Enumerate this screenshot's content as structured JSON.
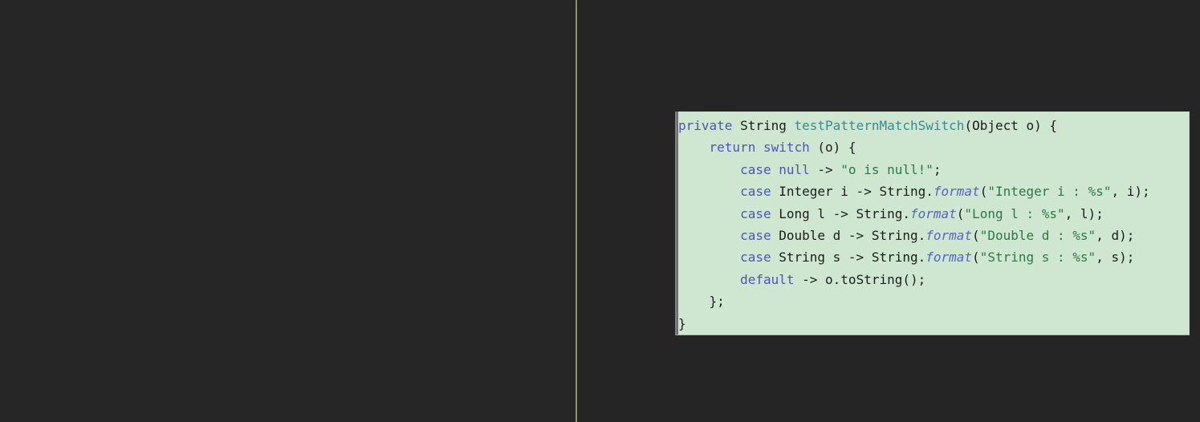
{
  "window": {
    "background_color": "#252525",
    "divider_color": "#8a9a55"
  },
  "panes": {
    "left": {
      "name": "left-editor-pane",
      "content": ""
    },
    "right": {
      "name": "right-editor-pane"
    }
  },
  "code_block": {
    "language": "Java",
    "background_color": "#cfe7d0",
    "colors": {
      "keyword": "#4957b8",
      "method_declaration": "#3a8a95",
      "method_call": "#5566c4",
      "string": "#2a7a45",
      "plain": "#1c1c1c"
    },
    "lines": [
      {
        "index": 1,
        "text": "private String testPatternMatchSwitch(Object o) {",
        "tokens": [
          {
            "t": "private",
            "c": "kw"
          },
          {
            "t": " ",
            "c": "pl"
          },
          {
            "t": "String",
            "c": "type"
          },
          {
            "t": " ",
            "c": "pl"
          },
          {
            "t": "testPatternMatchSwitch",
            "c": "fn"
          },
          {
            "t": "(Object o) {",
            "c": "pl"
          }
        ]
      },
      {
        "index": 2,
        "text": "    return switch (o) {",
        "tokens": [
          {
            "t": "    ",
            "c": "pl"
          },
          {
            "t": "return",
            "c": "kw"
          },
          {
            "t": " ",
            "c": "pl"
          },
          {
            "t": "switch",
            "c": "kw"
          },
          {
            "t": " (o) {",
            "c": "pl"
          }
        ]
      },
      {
        "index": 3,
        "text": "        case null -> \"o is null!\";",
        "tokens": [
          {
            "t": "        ",
            "c": "pl"
          },
          {
            "t": "case",
            "c": "kw"
          },
          {
            "t": " ",
            "c": "pl"
          },
          {
            "t": "null",
            "c": "kw"
          },
          {
            "t": " -> ",
            "c": "pl"
          },
          {
            "t": "\"o is null!\"",
            "c": "str"
          },
          {
            "t": ";",
            "c": "pl"
          }
        ]
      },
      {
        "index": 4,
        "text": "        case Integer i -> String.format(\"Integer i : %s\", i);",
        "tokens": [
          {
            "t": "        ",
            "c": "pl"
          },
          {
            "t": "case",
            "c": "kw"
          },
          {
            "t": " Integer i -> String.",
            "c": "pl"
          },
          {
            "t": "format",
            "c": "meth"
          },
          {
            "t": "(",
            "c": "pl"
          },
          {
            "t": "\"Integer i : %s\"",
            "c": "str"
          },
          {
            "t": ", i);",
            "c": "pl"
          }
        ]
      },
      {
        "index": 5,
        "text": "        case Long l -> String.format(\"Long l : %s\", l);",
        "tokens": [
          {
            "t": "        ",
            "c": "pl"
          },
          {
            "t": "case",
            "c": "kw"
          },
          {
            "t": " Long l -> String.",
            "c": "pl"
          },
          {
            "t": "format",
            "c": "meth"
          },
          {
            "t": "(",
            "c": "pl"
          },
          {
            "t": "\"Long l : %s\"",
            "c": "str"
          },
          {
            "t": ", l);",
            "c": "pl"
          }
        ]
      },
      {
        "index": 6,
        "text": "        case Double d -> String.format(\"Double d : %s\", d);",
        "tokens": [
          {
            "t": "        ",
            "c": "pl"
          },
          {
            "t": "case",
            "c": "kw"
          },
          {
            "t": " Double d -> String.",
            "c": "pl"
          },
          {
            "t": "format",
            "c": "meth"
          },
          {
            "t": "(",
            "c": "pl"
          },
          {
            "t": "\"Double d : %s\"",
            "c": "str"
          },
          {
            "t": ", d);",
            "c": "pl"
          }
        ]
      },
      {
        "index": 7,
        "text": "        case String s -> String.format(\"String s : %s\", s);",
        "tokens": [
          {
            "t": "        ",
            "c": "pl"
          },
          {
            "t": "case",
            "c": "kw"
          },
          {
            "t": " String s -> String.",
            "c": "pl"
          },
          {
            "t": "format",
            "c": "meth"
          },
          {
            "t": "(",
            "c": "pl"
          },
          {
            "t": "\"String s : %s\"",
            "c": "str"
          },
          {
            "t": ", s);",
            "c": "pl"
          }
        ]
      },
      {
        "index": 8,
        "text": "        default -> o.toString();",
        "tokens": [
          {
            "t": "        ",
            "c": "pl"
          },
          {
            "t": "default",
            "c": "kw"
          },
          {
            "t": " -> o.toString();",
            "c": "pl"
          }
        ]
      },
      {
        "index": 9,
        "text": "    };",
        "tokens": [
          {
            "t": "    };",
            "c": "pl"
          }
        ]
      },
      {
        "index": 10,
        "text": "}",
        "tokens": [
          {
            "t": "}",
            "c": "pl"
          }
        ]
      }
    ]
  }
}
